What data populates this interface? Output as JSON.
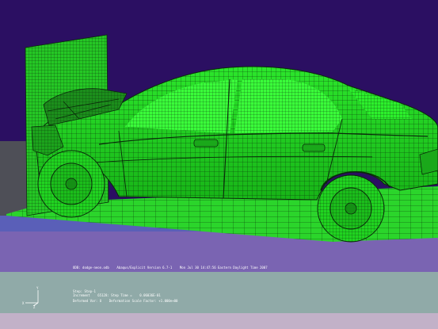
{
  "viewport_title": "ODB: dodge-neon.odb    Abaqus/Explicit Version 6.7-1    Mon Jul 30 14:47:56 Eastern Daylight Time 2007",
  "step_info": {
    "step": "Step: Step-1",
    "increment": "Increment    65128: Step Time =    0.06036E-01",
    "deformed_var": "Deformed Var: U    Deformation Scale Factor: +1.000e+00"
  },
  "triad_labels": {
    "x": "X",
    "y": "Y",
    "z": "Z"
  },
  "colors": {
    "background_top": "#2b0f62",
    "background_bottom": "#7a64b2",
    "floor_band": "#5a5fb8",
    "footer_panel": "#90aaa8",
    "bottom_strip": "#c2b1c8",
    "left_wall": "#4e4f57",
    "mesh_fill": "#1ee21e",
    "mesh_fill_bright": "#3aff3a",
    "mesh_lines": "#0a2a0a",
    "tire": "#20d420"
  }
}
